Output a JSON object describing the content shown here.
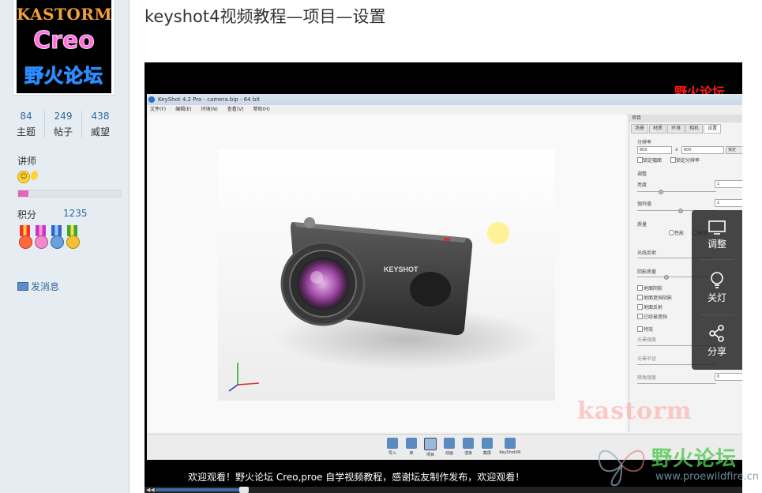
{
  "sidebar": {
    "avatar": {
      "line1": "KASTORM",
      "line2": "Creo",
      "line3": "野火论坛"
    },
    "stats": [
      {
        "value": "84",
        "label": "主题"
      },
      {
        "value": "249",
        "label": "帖子"
      },
      {
        "value": "438",
        "label": "威望"
      }
    ],
    "rank": "讲师",
    "progress_fraction": 0.1,
    "score_label": "积分",
    "score_value": "1235",
    "message_link": "发消息"
  },
  "post": {
    "title": "keyshot4视频教程—项目—设置"
  },
  "video": {
    "watermark_top": "野火论坛",
    "watermark_bottom": "kastorm",
    "subtitle": "欢迎观看！野火论坛 Creo,proe 自学视频教程，感谢坛友制作发布，欢迎观看！",
    "progress_fraction": 0.16,
    "keyshot": {
      "window_title": "KeyShot 4.2 Pro - camera.bip - 64 bit",
      "menu": [
        "文件(F)",
        "编辑(E)",
        "环境(N)",
        "查看(V)",
        "帮助(H)"
      ],
      "panel_title": "项目",
      "tabs": [
        "场景",
        "材质",
        "环境",
        "相机",
        "设置"
      ],
      "active_tab": "设置",
      "panel_rows": {
        "resolution": "分辨率",
        "res_w": "800",
        "res_x": "x",
        "res_h": "600",
        "apply": "锁定",
        "lock_aspect": "锁定幅面",
        "lock_res": "锁定分辨率",
        "adjust": "调整",
        "brightness": "亮度",
        "brightness_val": "1",
        "gamma": "伽玛值",
        "gamma_val": "2",
        "quality": "质量",
        "perf": "性能",
        "advanced": "高级",
        "rays": "光线反射",
        "detail": "阴影质量",
        "cb1": "地面阴影",
        "cb2": "地面遮挡阴影",
        "cb3": "地面反射",
        "cb4": "已经被遮挡",
        "cb5": "特效",
        "bloom": "光晕强度",
        "bloom_r": "光晕半径",
        "vignette": "暗角强度",
        "vignette_val": "0"
      },
      "tools": [
        "导入",
        "库",
        "项目",
        "动画",
        "渲染",
        "截屏",
        "KeyShotVR"
      ],
      "camera_label": "KEYSHOT"
    }
  },
  "player_controls": [
    {
      "label": "调整",
      "icon": "monitor-icon"
    },
    {
      "label": "关灯",
      "icon": "bulb-icon"
    },
    {
      "label": "分享",
      "icon": "share-icon"
    }
  ],
  "site_watermark": {
    "name": "野火论坛",
    "url": "www.proewildfire.cn"
  }
}
